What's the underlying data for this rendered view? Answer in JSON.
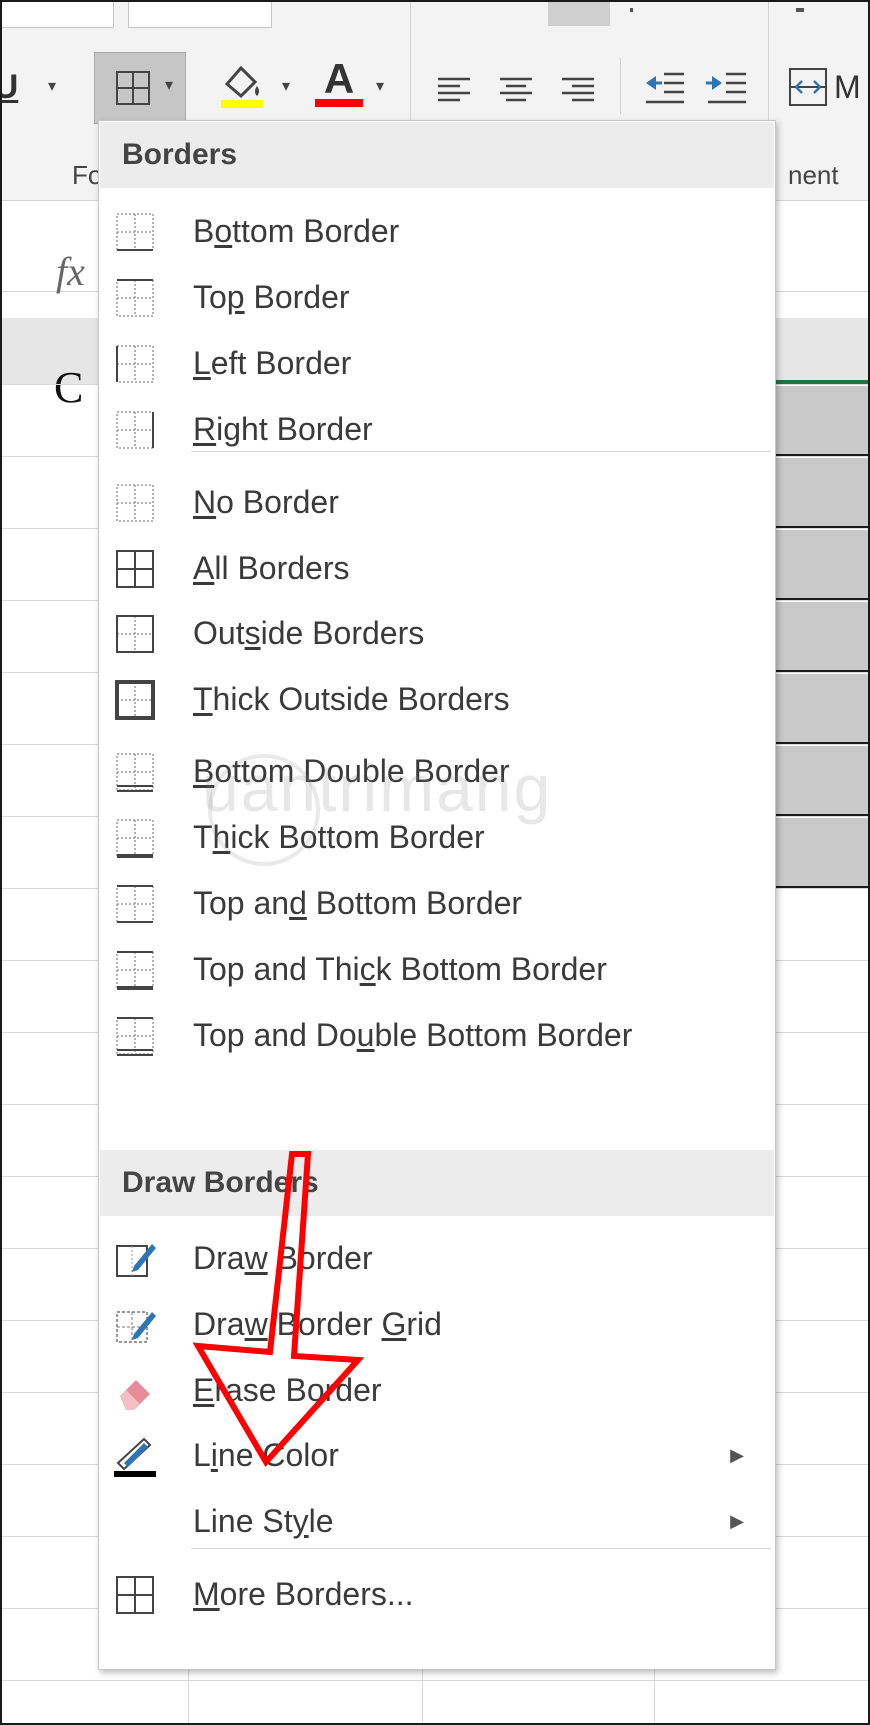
{
  "ribbon": {
    "groups": {
      "font_partial": "Fo",
      "alignment_partial": "nent"
    },
    "merge_label_partial": "M",
    "icons": [
      "underline-icon",
      "borders-icon",
      "fill-color-icon",
      "font-color-icon",
      "align-left-icon",
      "align-center-icon",
      "align-right-icon",
      "decrease-indent-icon",
      "increase-indent-icon",
      "merge-icon"
    ],
    "font_color_letter": "A",
    "underline_letter": "U",
    "fill_color": "#ffff00",
    "font_color": "#ff0000"
  },
  "formula_bar": {
    "fx": "fx"
  },
  "sheet": {
    "column_header": "C"
  },
  "menu": {
    "section_borders": "Borders",
    "section_draw": "Draw Borders",
    "items": [
      {
        "pre": "B",
        "u": "o",
        "post": "ttom Border",
        "icon": "bottom-border-icon"
      },
      {
        "pre": "To",
        "u": "p",
        "post": " Border",
        "icon": "top-border-icon"
      },
      {
        "pre": "",
        "u": "L",
        "post": "eft Border",
        "icon": "left-border-icon"
      },
      {
        "pre": "",
        "u": "R",
        "post": "ight Border",
        "icon": "right-border-icon"
      },
      {
        "pre": "",
        "u": "N",
        "post": "o Border",
        "icon": "no-border-icon"
      },
      {
        "pre": "",
        "u": "A",
        "post": "ll Borders",
        "icon": "all-borders-icon"
      },
      {
        "pre": "Out",
        "u": "s",
        "post": "ide Borders",
        "icon": "outside-borders-icon"
      },
      {
        "pre": "",
        "u": "T",
        "post": "hick Outside Borders",
        "icon": "thick-outside-borders-icon"
      },
      {
        "pre": "",
        "u": "B",
        "post": "ottom Double Border",
        "icon": "bottom-double-border-icon"
      },
      {
        "pre": "T",
        "u": "h",
        "post": "ick Bottom Border",
        "icon": "thick-bottom-border-icon"
      },
      {
        "pre": "Top an",
        "u": "d",
        "post": " Bottom Border",
        "icon": "top-and-bottom-border-icon"
      },
      {
        "pre": "Top and Thi",
        "u": "c",
        "post": "k Bottom Border",
        "icon": "top-and-thick-bottom-border-icon"
      },
      {
        "pre": "Top and Do",
        "u": "u",
        "post": "ble Bottom Border",
        "icon": "top-and-double-bottom-border-icon"
      }
    ],
    "draw_items": [
      {
        "pre": "Dra",
        "u": "w",
        "post": " Border",
        "icon": "draw-border-icon"
      },
      {
        "pre": "Dra",
        "u": "w",
        "post": " Border ",
        "u2": "G",
        "post2": "rid",
        "icon": "draw-border-grid-icon"
      },
      {
        "pre": "",
        "u": "E",
        "post": "rase Border",
        "icon": "eraser-icon"
      },
      {
        "pre": "L",
        "u": "i",
        "post": "ne Color",
        "icon": "line-color-icon",
        "submenu": true
      },
      {
        "pre": "Line St",
        "u": "y",
        "post": "le",
        "icon": "",
        "submenu": true
      },
      {
        "pre": "",
        "u": "M",
        "post": "ore Borders...",
        "icon": "more-borders-icon"
      }
    ]
  },
  "watermark": "uantrimang",
  "colors": {
    "annotation_arrow": "#ff0000",
    "line_color_swatch": "#000000",
    "draw_pen": "#2e75b6"
  }
}
